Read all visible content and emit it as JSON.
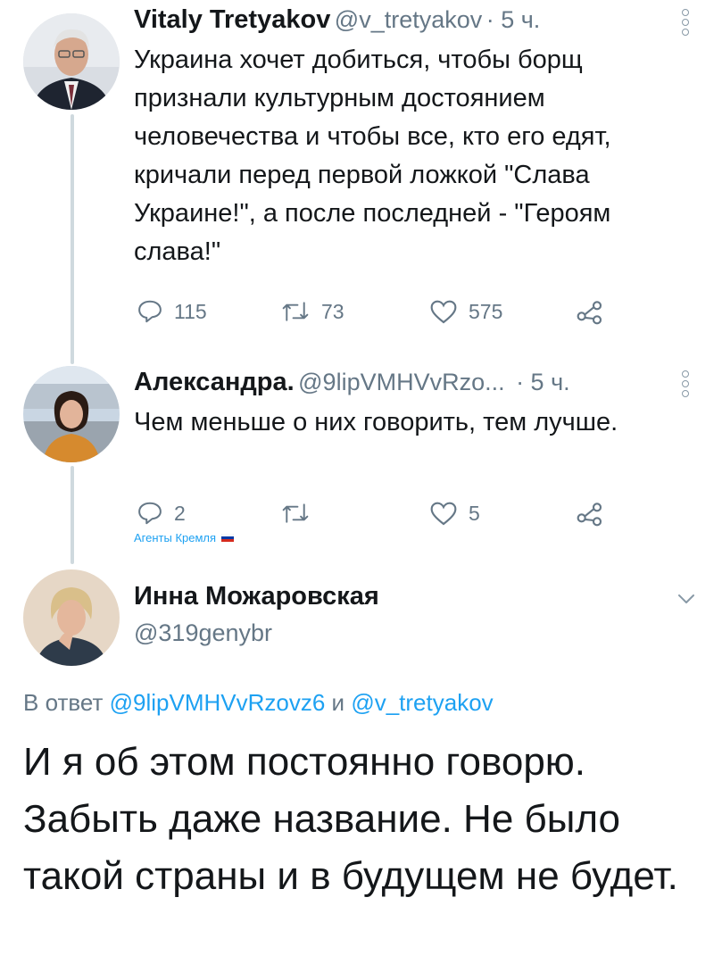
{
  "tweet1": {
    "name": "Vitaly Tretyakov",
    "handle": "@v_tretyakov",
    "time": "· 5 ч.",
    "text": "Украина хочет добиться, чтобы борщ признали культурным достоянием человечества и чтобы все, кто его едят, кричали перед первой ложкой \"Слава Украине!\", а после последней - \"Героям слава!\"",
    "replies": "115",
    "retweets": "73",
    "likes": "575"
  },
  "tweet2": {
    "name": "Александра.",
    "handle": "@9lipVMHVvRzo...",
    "time": "· 5 ч.",
    "text": "Чем меньше о них говорить, тем лучше.",
    "replies": "2",
    "retweets": "",
    "likes": "5",
    "sub_label": "Агенты Кремля"
  },
  "tweet3": {
    "name": "Инна Можаровская",
    "handle": "@319genybr",
    "reply_prefix": "В ответ",
    "reply_handle1": "@9lipVMHVvRzovz6",
    "reply_and": "и",
    "reply_handle2": "@v_tretyakov",
    "text": "И я об этом постоянно говорю. Забыть даже название. Не было такой страны и в будущем не будет."
  },
  "icons": [
    "reply-icon",
    "retweet-icon",
    "like-icon",
    "share-icon",
    "more-icon",
    "chevron-down-icon"
  ],
  "colors": {
    "link": "#1da1f2",
    "muted": "#657786",
    "text": "#14171a"
  }
}
